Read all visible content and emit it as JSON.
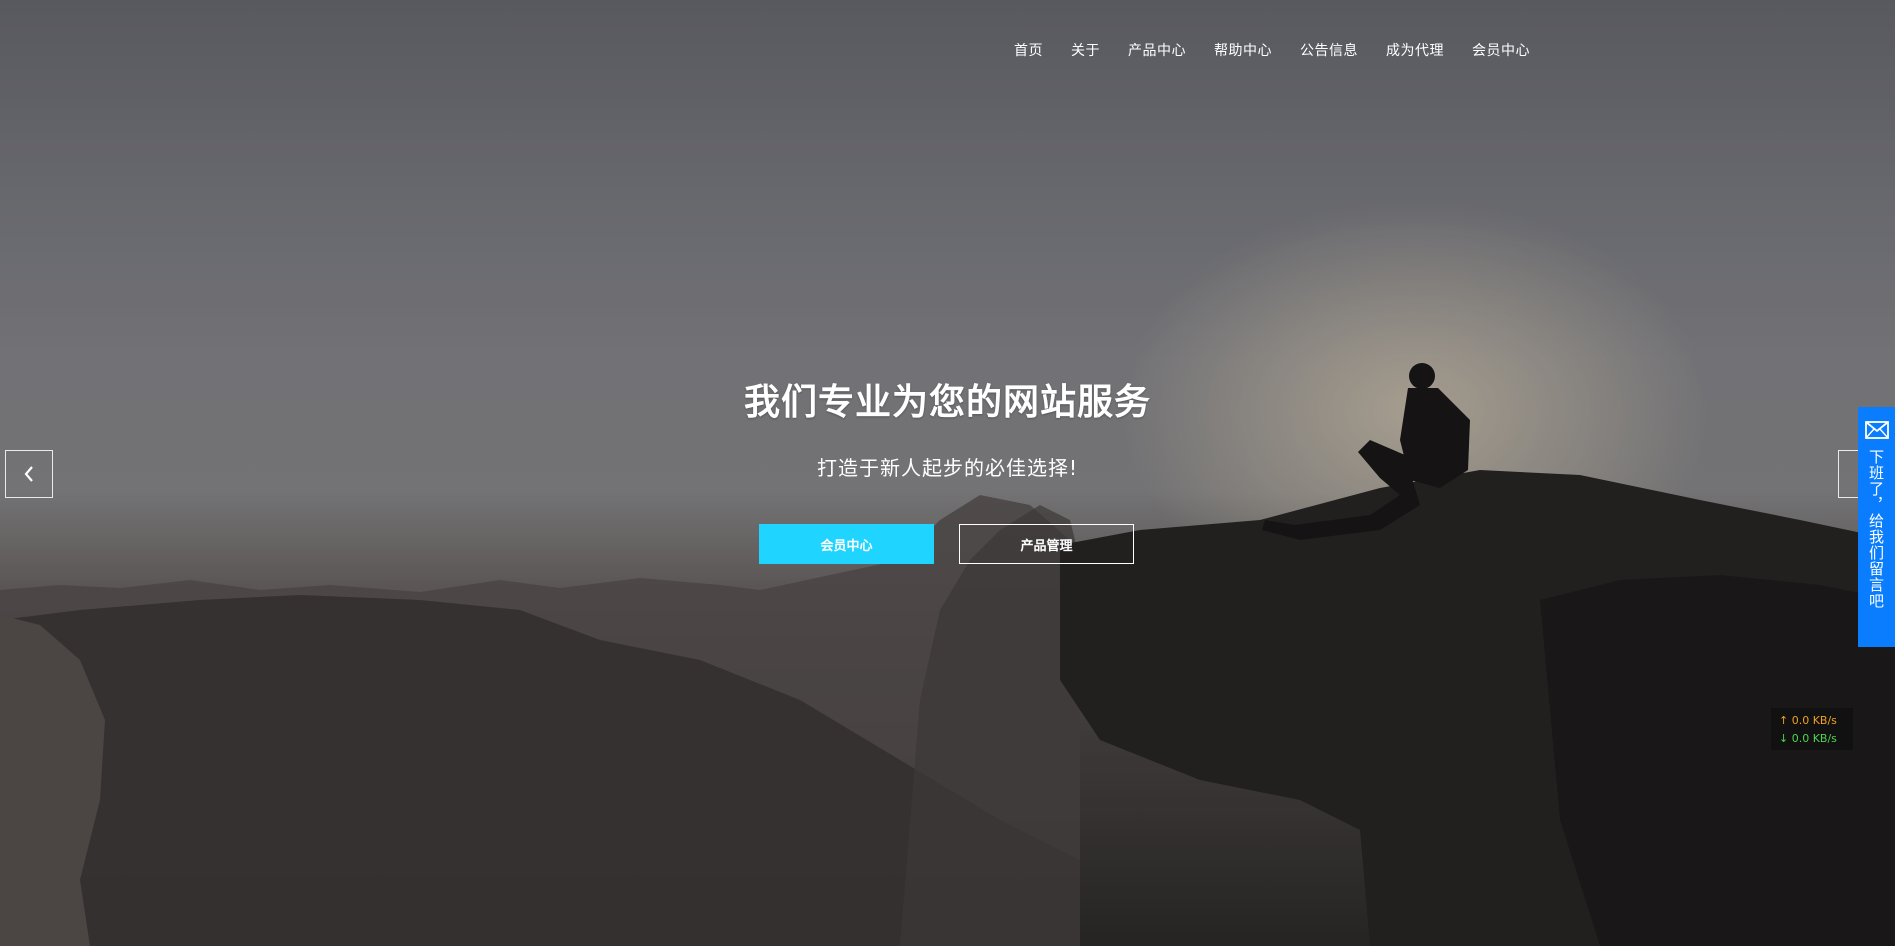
{
  "nav": {
    "items": [
      {
        "label": "首页"
      },
      {
        "label": "关于"
      },
      {
        "label": "产品中心"
      },
      {
        "label": "帮助中心"
      },
      {
        "label": "公告信息"
      },
      {
        "label": "成为代理"
      },
      {
        "label": "会员中心"
      }
    ]
  },
  "hero": {
    "headline": "我们专业为您的网站服务",
    "subline": "打造于新人起步的必佳选择!",
    "primary_button": "会员中心",
    "secondary_button": "产品管理"
  },
  "slider": {
    "prev_icon": "chevron-left-icon",
    "next_icon": "chevron-right-icon"
  },
  "side_tab": {
    "icon": "mail-icon",
    "text": "下班了，给我们留言吧"
  },
  "speed_widget": {
    "upload": "↑ 0.0 KB/s",
    "download": "↓ 0.0 KB/s"
  },
  "colors": {
    "primary_button": "#1fd4ff",
    "side_tab": "#0a7dff"
  }
}
